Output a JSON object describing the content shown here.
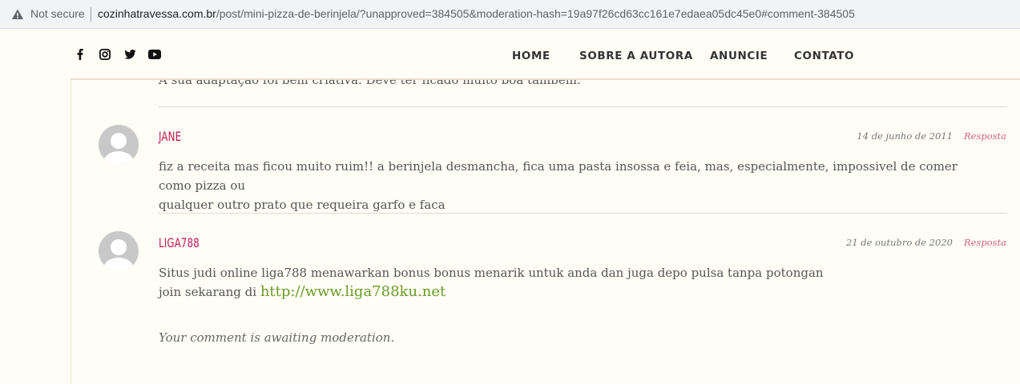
{
  "browser": {
    "security_label": "Not secure",
    "url_host": "cozinhatravessa.com.br",
    "url_path": "/post/mini-pizza-de-berinjela/?unapproved=384505&moderation-hash=19a97f26cd63cc161e7edaea05dc45e0#comment-384505"
  },
  "header": {
    "social": [
      "facebook-icon",
      "instagram-icon",
      "twitter-icon",
      "youtube-icon"
    ],
    "nav": [
      "HOME",
      "SOBRE A AUTORA",
      "ANUNCIE",
      "CONTATO"
    ]
  },
  "clipped_comment_text": "A sua adaptação foi bem criativa. Deve ter ficado muito boa também.",
  "comments": [
    {
      "author": "JANE",
      "date": "14 de junho de 2011",
      "reply_label": "Resposta",
      "lines": [
        "fiz a receita mas ficou muito ruim!! a berinjela desmancha, fica uma pasta insossa e feia, mas, especialmente, impossivel de comer como pizza ou",
        "qualquer outro prato que requeira garfo e faca"
      ]
    },
    {
      "author": "LIGA788",
      "date": "21 de outubro de 2020",
      "reply_label": "Resposta",
      "line1": "Situs judi online liga788 menawarkan bonus bonus menarik untuk anda dan juga depo pulsa tanpa potongan",
      "line2_prefix": "join sekarang di ",
      "link": "http://www.liga788ku.net",
      "moderation_note": "Your comment is awaiting moderation."
    }
  ],
  "colors": {
    "author": "#c2185b",
    "reply": "#d06080",
    "link": "#6a9a2a",
    "background": "#fffdf5"
  }
}
